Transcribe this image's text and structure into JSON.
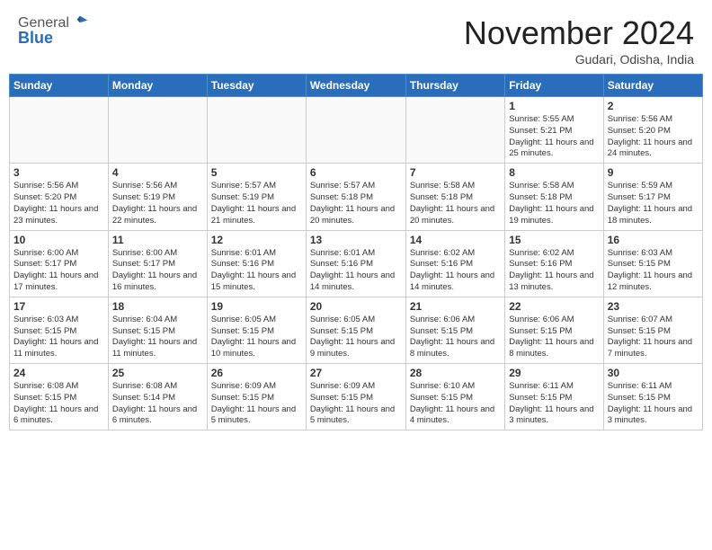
{
  "logo": {
    "general": "General",
    "blue": "Blue"
  },
  "header": {
    "month": "November 2024",
    "location": "Gudari, Odisha, India"
  },
  "weekdays": [
    "Sunday",
    "Monday",
    "Tuesday",
    "Wednesday",
    "Thursday",
    "Friday",
    "Saturday"
  ],
  "weeks": [
    [
      {
        "day": "",
        "info": ""
      },
      {
        "day": "",
        "info": ""
      },
      {
        "day": "",
        "info": ""
      },
      {
        "day": "",
        "info": ""
      },
      {
        "day": "",
        "info": ""
      },
      {
        "day": "1",
        "info": "Sunrise: 5:55 AM\nSunset: 5:21 PM\nDaylight: 11 hours and 25 minutes."
      },
      {
        "day": "2",
        "info": "Sunrise: 5:56 AM\nSunset: 5:20 PM\nDaylight: 11 hours and 24 minutes."
      }
    ],
    [
      {
        "day": "3",
        "info": "Sunrise: 5:56 AM\nSunset: 5:20 PM\nDaylight: 11 hours and 23 minutes."
      },
      {
        "day": "4",
        "info": "Sunrise: 5:56 AM\nSunset: 5:19 PM\nDaylight: 11 hours and 22 minutes."
      },
      {
        "day": "5",
        "info": "Sunrise: 5:57 AM\nSunset: 5:19 PM\nDaylight: 11 hours and 21 minutes."
      },
      {
        "day": "6",
        "info": "Sunrise: 5:57 AM\nSunset: 5:18 PM\nDaylight: 11 hours and 20 minutes."
      },
      {
        "day": "7",
        "info": "Sunrise: 5:58 AM\nSunset: 5:18 PM\nDaylight: 11 hours and 20 minutes."
      },
      {
        "day": "8",
        "info": "Sunrise: 5:58 AM\nSunset: 5:18 PM\nDaylight: 11 hours and 19 minutes."
      },
      {
        "day": "9",
        "info": "Sunrise: 5:59 AM\nSunset: 5:17 PM\nDaylight: 11 hours and 18 minutes."
      }
    ],
    [
      {
        "day": "10",
        "info": "Sunrise: 6:00 AM\nSunset: 5:17 PM\nDaylight: 11 hours and 17 minutes."
      },
      {
        "day": "11",
        "info": "Sunrise: 6:00 AM\nSunset: 5:17 PM\nDaylight: 11 hours and 16 minutes."
      },
      {
        "day": "12",
        "info": "Sunrise: 6:01 AM\nSunset: 5:16 PM\nDaylight: 11 hours and 15 minutes."
      },
      {
        "day": "13",
        "info": "Sunrise: 6:01 AM\nSunset: 5:16 PM\nDaylight: 11 hours and 14 minutes."
      },
      {
        "day": "14",
        "info": "Sunrise: 6:02 AM\nSunset: 5:16 PM\nDaylight: 11 hours and 14 minutes."
      },
      {
        "day": "15",
        "info": "Sunrise: 6:02 AM\nSunset: 5:16 PM\nDaylight: 11 hours and 13 minutes."
      },
      {
        "day": "16",
        "info": "Sunrise: 6:03 AM\nSunset: 5:15 PM\nDaylight: 11 hours and 12 minutes."
      }
    ],
    [
      {
        "day": "17",
        "info": "Sunrise: 6:03 AM\nSunset: 5:15 PM\nDaylight: 11 hours and 11 minutes."
      },
      {
        "day": "18",
        "info": "Sunrise: 6:04 AM\nSunset: 5:15 PM\nDaylight: 11 hours and 11 minutes."
      },
      {
        "day": "19",
        "info": "Sunrise: 6:05 AM\nSunset: 5:15 PM\nDaylight: 11 hours and 10 minutes."
      },
      {
        "day": "20",
        "info": "Sunrise: 6:05 AM\nSunset: 5:15 PM\nDaylight: 11 hours and 9 minutes."
      },
      {
        "day": "21",
        "info": "Sunrise: 6:06 AM\nSunset: 5:15 PM\nDaylight: 11 hours and 8 minutes."
      },
      {
        "day": "22",
        "info": "Sunrise: 6:06 AM\nSunset: 5:15 PM\nDaylight: 11 hours and 8 minutes."
      },
      {
        "day": "23",
        "info": "Sunrise: 6:07 AM\nSunset: 5:15 PM\nDaylight: 11 hours and 7 minutes."
      }
    ],
    [
      {
        "day": "24",
        "info": "Sunrise: 6:08 AM\nSunset: 5:15 PM\nDaylight: 11 hours and 6 minutes."
      },
      {
        "day": "25",
        "info": "Sunrise: 6:08 AM\nSunset: 5:14 PM\nDaylight: 11 hours and 6 minutes."
      },
      {
        "day": "26",
        "info": "Sunrise: 6:09 AM\nSunset: 5:15 PM\nDaylight: 11 hours and 5 minutes."
      },
      {
        "day": "27",
        "info": "Sunrise: 6:09 AM\nSunset: 5:15 PM\nDaylight: 11 hours and 5 minutes."
      },
      {
        "day": "28",
        "info": "Sunrise: 6:10 AM\nSunset: 5:15 PM\nDaylight: 11 hours and 4 minutes."
      },
      {
        "day": "29",
        "info": "Sunrise: 6:11 AM\nSunset: 5:15 PM\nDaylight: 11 hours and 3 minutes."
      },
      {
        "day": "30",
        "info": "Sunrise: 6:11 AM\nSunset: 5:15 PM\nDaylight: 11 hours and 3 minutes."
      }
    ]
  ]
}
